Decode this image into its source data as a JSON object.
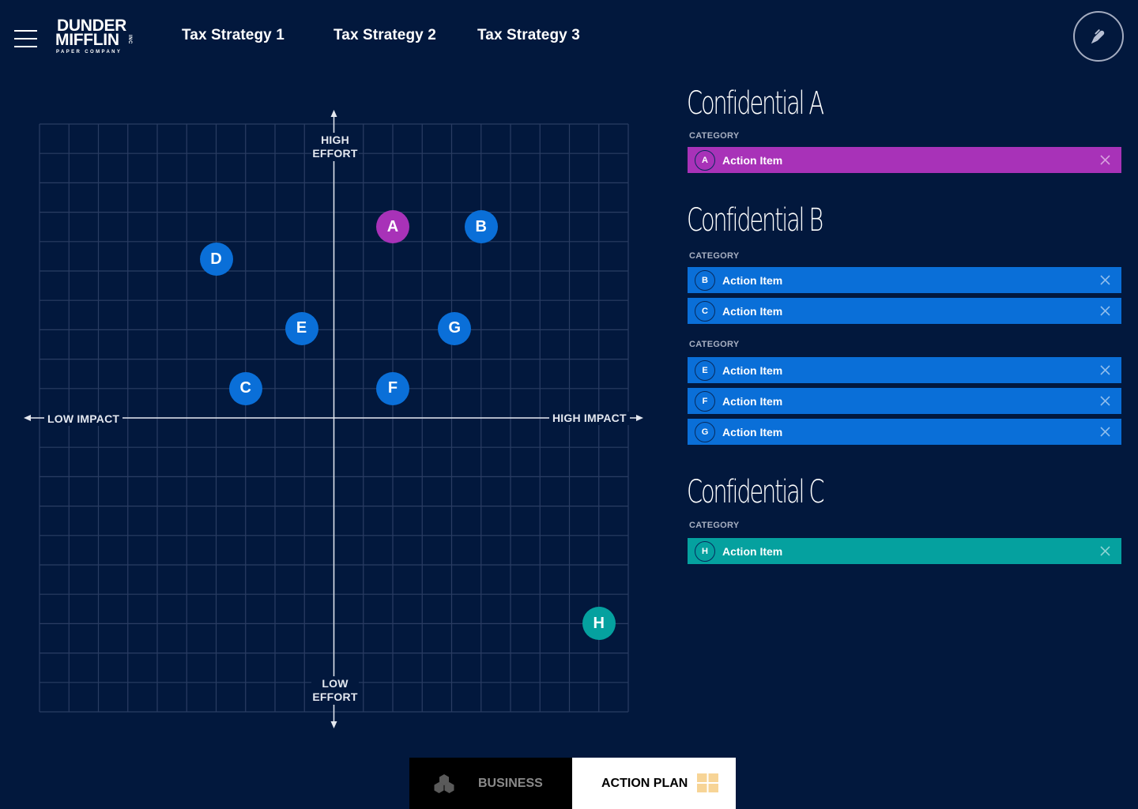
{
  "header": {
    "menu_icon": "hamburger-menu-icon",
    "logo": {
      "line1": "DUNDER",
      "line2": "MIFFLIN",
      "inc": "INC",
      "tagline": "PAPER COMPANY"
    },
    "tabs": [
      {
        "label": "Tax Strategy 1"
      },
      {
        "label": "Tax Strategy 2"
      },
      {
        "label": "Tax Strategy 3"
      }
    ],
    "action_icon": "pen-icon"
  },
  "colors": {
    "background": "#02183d",
    "grid": "#2a3d63",
    "axis": "#e4e8f0",
    "group_a": "#a832b8",
    "group_b": "#0a6fd8",
    "group_c": "#05a19f"
  },
  "chart_data": {
    "type": "scatter",
    "title": "",
    "xlabel_low": "LOW IMPACT",
    "xlabel_high": "HIGH IMPACT",
    "ylabel_high_line1": "HIGH",
    "ylabel_high_line2": "EFFORT",
    "ylabel_low_line1": "LOW",
    "ylabel_low_line2": "EFFORT",
    "xlim": [
      -10,
      10
    ],
    "ylim": [
      -10,
      10
    ],
    "grid": true,
    "grid_divisions": 20,
    "points": [
      {
        "label": "A",
        "x": 2,
        "y": 6.5,
        "group": "group_a"
      },
      {
        "label": "B",
        "x": 5,
        "y": 6.5,
        "group": "group_b"
      },
      {
        "label": "C",
        "x": -3,
        "y": 1,
        "group": "group_b"
      },
      {
        "label": "D",
        "x": -4,
        "y": 5.4,
        "group": "group_b"
      },
      {
        "label": "E",
        "x": -1.1,
        "y": 3.05,
        "group": "group_b"
      },
      {
        "label": "F",
        "x": 2,
        "y": 1,
        "group": "group_b"
      },
      {
        "label": "G",
        "x": 4.1,
        "y": 3.05,
        "group": "group_b"
      },
      {
        "label": "H",
        "x": 9,
        "y": -7,
        "group": "group_c"
      }
    ]
  },
  "panel": {
    "sections": [
      {
        "title": "Confidential A",
        "groups": [
          {
            "category": "CATEGORY",
            "items": [
              {
                "badge": "A",
                "label": "Action Item",
                "color": "group_a"
              }
            ]
          }
        ]
      },
      {
        "title": "Confidential B",
        "groups": [
          {
            "category": "CATEGORY",
            "items": [
              {
                "badge": "B",
                "label": "Action Item",
                "color": "group_b"
              },
              {
                "badge": "C",
                "label": "Action Item",
                "color": "group_b"
              }
            ]
          },
          {
            "category": "CATEGORY",
            "items": [
              {
                "badge": "E",
                "label": "Action Item",
                "color": "group_b"
              },
              {
                "badge": "F",
                "label": "Action Item",
                "color": "group_b"
              },
              {
                "badge": "G",
                "label": "Action Item",
                "color": "group_b"
              }
            ]
          }
        ]
      },
      {
        "title": "Confidential C",
        "groups": [
          {
            "category": "CATEGORY",
            "items": [
              {
                "badge": "H",
                "label": "Action Item",
                "color": "group_c"
              }
            ]
          }
        ]
      }
    ]
  },
  "bottom_tabs": {
    "business": {
      "label": "BUSINESS",
      "icon": "hexagons-icon",
      "active": false
    },
    "action_plan": {
      "label": "ACTION PLAN",
      "icon": "grid-squares-icon",
      "active": true
    }
  }
}
